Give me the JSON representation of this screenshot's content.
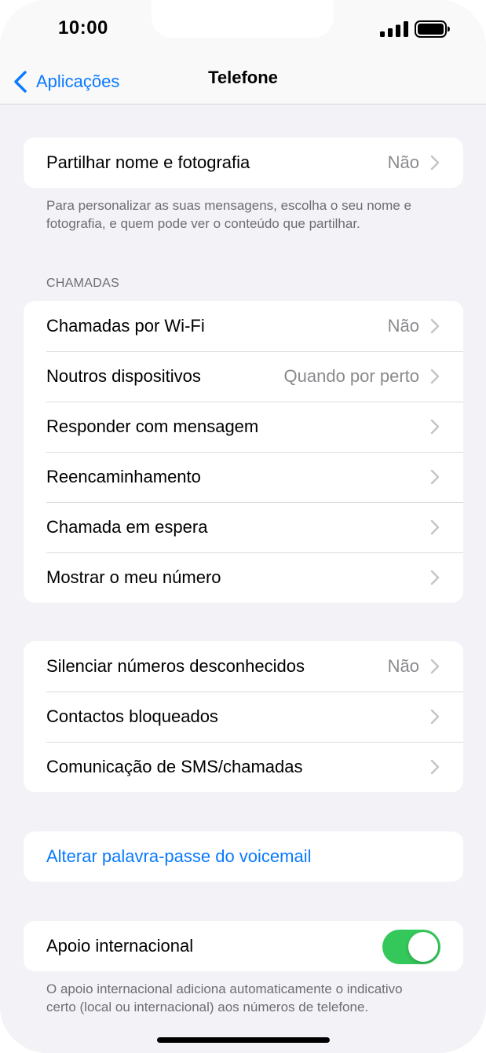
{
  "status_bar": {
    "time": "10:00",
    "signal_icon": "cellular-signal-icon",
    "battery_icon": "battery-icon"
  },
  "nav": {
    "back_label": "Aplicações",
    "title": "Telefone"
  },
  "share_group": {
    "label": "Partilhar nome e fotografia",
    "value": "Não",
    "footnote": "Para personalizar as suas mensagens, escolha o seu nome e fotografia, e quem pode ver o conteúdo que partilhar."
  },
  "calls_section": {
    "header": "CHAMADAS",
    "rows": [
      {
        "label": "Chamadas por Wi-Fi",
        "value": "Não"
      },
      {
        "label": "Noutros dispositivos",
        "value": "Quando por perto"
      },
      {
        "label": "Responder com mensagem",
        "value": ""
      },
      {
        "label": "Reencaminhamento",
        "value": ""
      },
      {
        "label": "Chamada em espera",
        "value": ""
      },
      {
        "label": "Mostrar o meu número",
        "value": ""
      }
    ]
  },
  "block_section": {
    "rows": [
      {
        "label": "Silenciar números desconhecidos",
        "value": "Não"
      },
      {
        "label": "Contactos bloqueados",
        "value": ""
      },
      {
        "label": "Comunicação de SMS/chamadas",
        "value": ""
      }
    ]
  },
  "voicemail": {
    "label": "Alterar palavra-passe do voicemail"
  },
  "international": {
    "label": "Apoio internacional",
    "enabled": true,
    "toggle_color": "#34c759",
    "footnote": "O apoio internacional adiciona automaticamente o indicativo certo (local ou internacional) aos números de telefone."
  },
  "colors": {
    "accent": "#0a7aff",
    "background": "#f2f2f7",
    "secondary_text": "#8a8a8e"
  }
}
